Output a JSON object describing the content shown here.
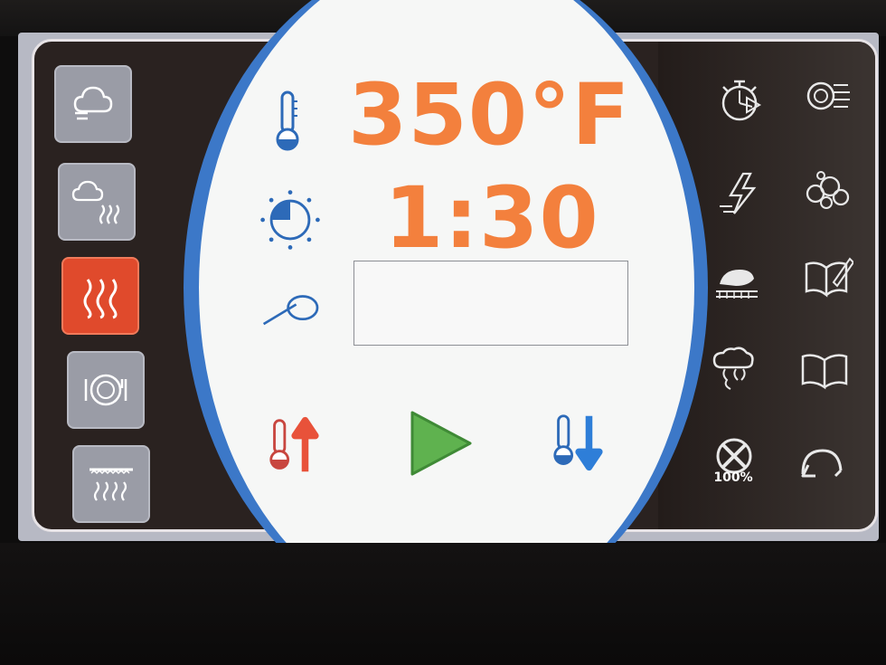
{
  "display": {
    "temperature": "350°F",
    "time": "1:30",
    "message": ""
  },
  "mode_buttons": [
    {
      "icon": "steam-icon",
      "active": false
    },
    {
      "icon": "combi-steam-heat-icon",
      "active": false
    },
    {
      "icon": "convection-heat-icon",
      "active": true
    },
    {
      "icon": "plate-regeneration-icon",
      "active": false
    },
    {
      "icon": "low-temp-heat-icon",
      "active": false
    }
  ],
  "center_icons": {
    "temp": "thermometer-icon",
    "timer": "timer-dial-icon",
    "probe": "core-probe-icon",
    "temp_up": "temperature-up-icon",
    "start": "play-start-icon",
    "temp_down": "temperature-down-icon"
  },
  "right_icons": [
    "stopwatch-icon",
    "steam-vent-icon",
    "cooldown-icon",
    "clean-bubbles-icon",
    "roast-icon",
    "recipe-edit-book-icon",
    "smoke-icon",
    "recipe-book-icon",
    "fan-speed-icon",
    "back-arrow-icon"
  ],
  "fan": {
    "label": "100%"
  },
  "colors": {
    "accent_orange": "#f3803d",
    "active_mode_red": "#e04a2c",
    "oval_blue": "#3c78c8",
    "start_green": "#5fb24f"
  }
}
